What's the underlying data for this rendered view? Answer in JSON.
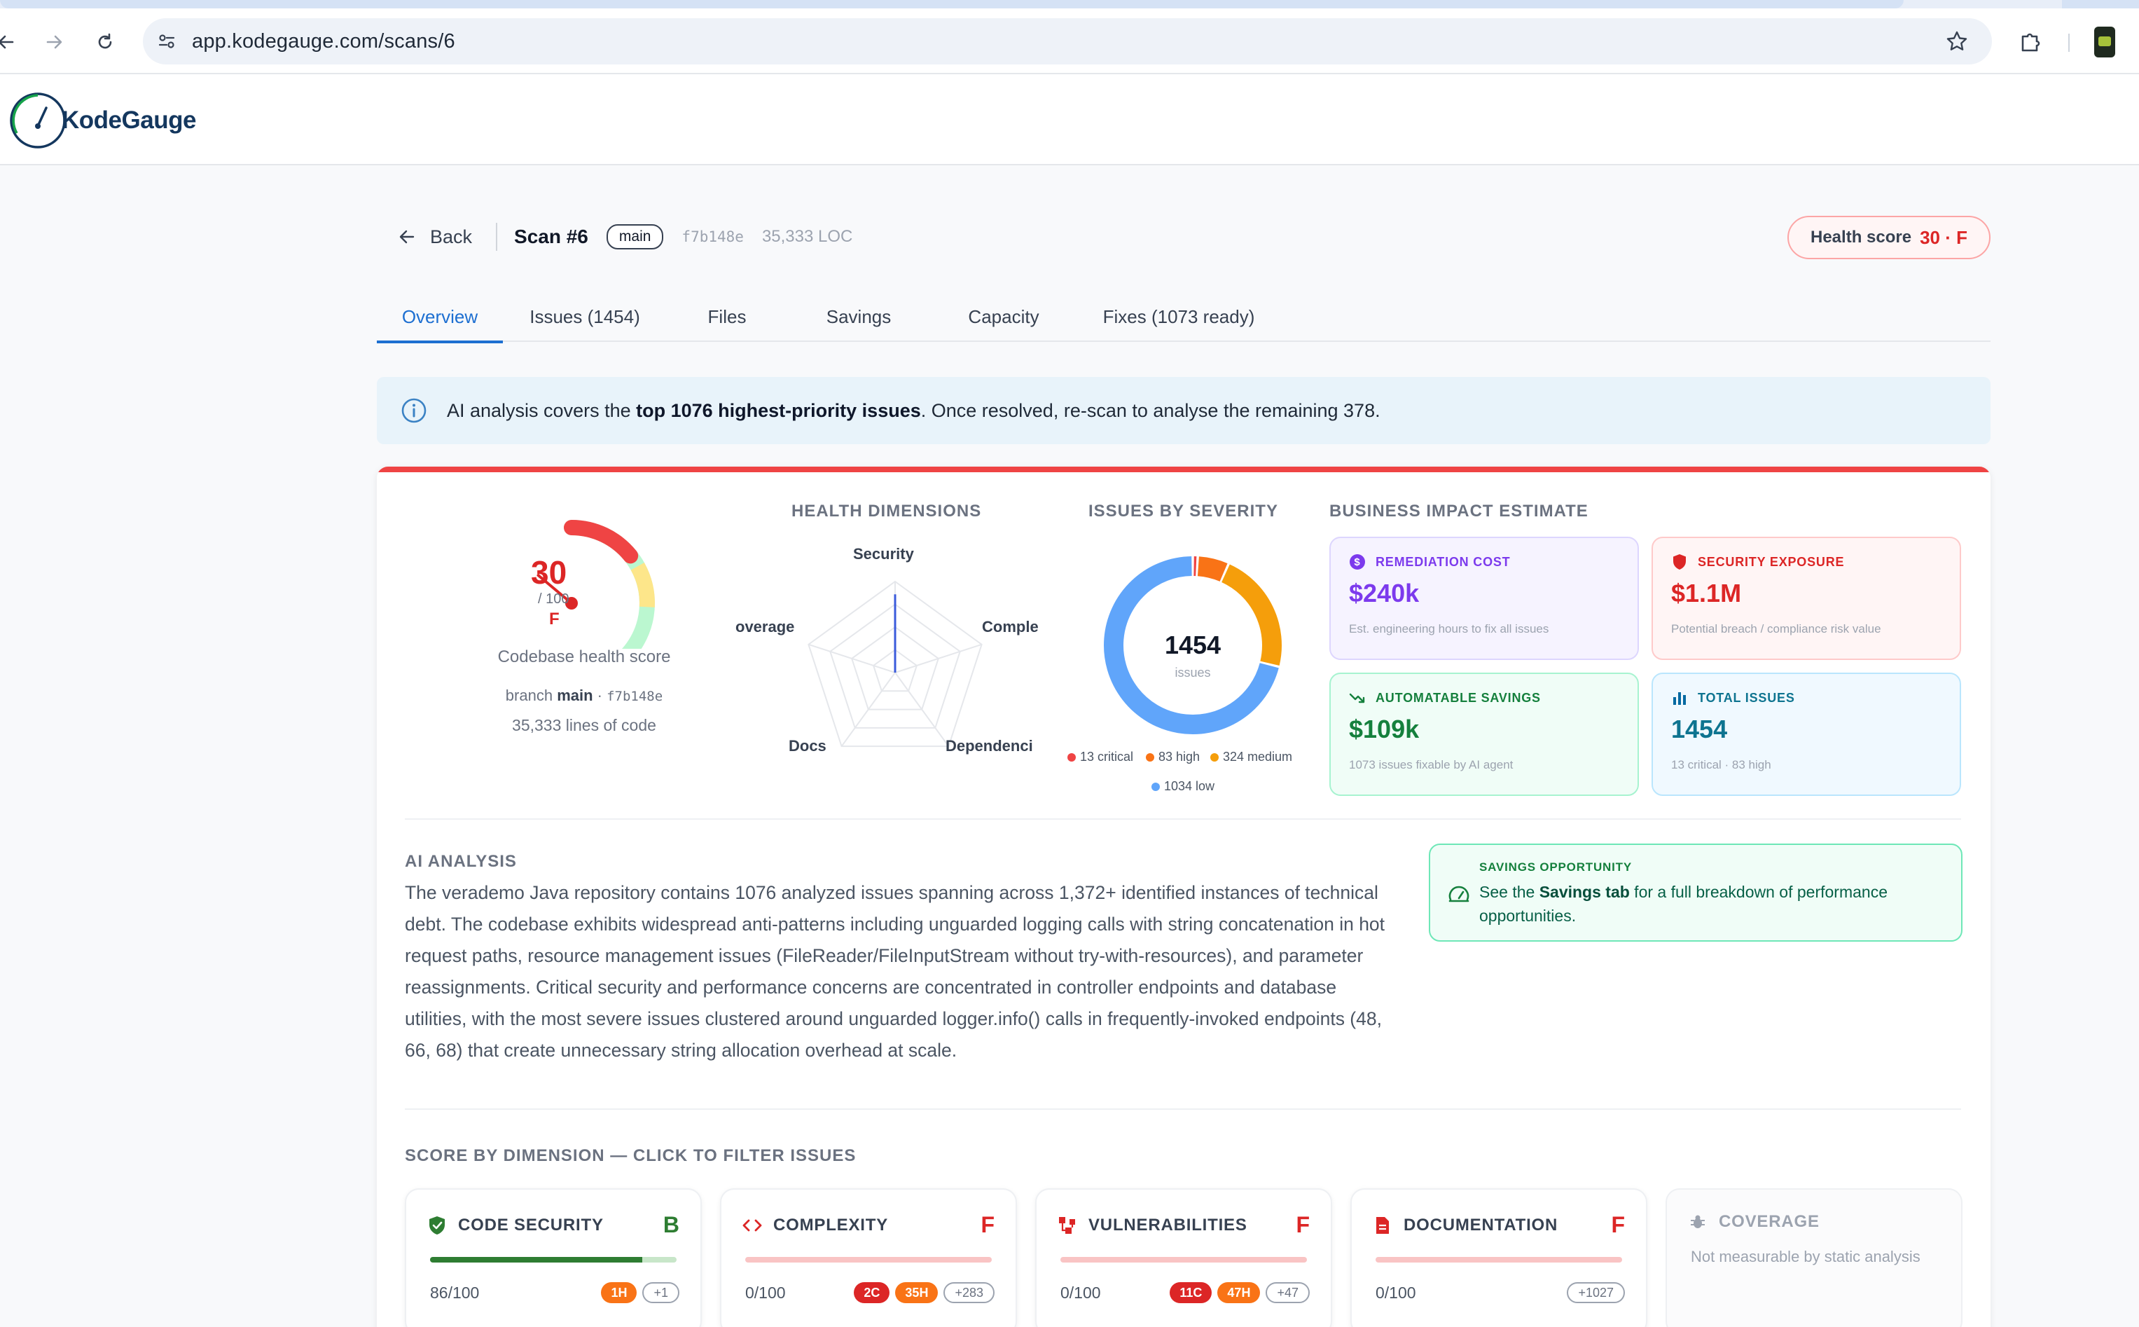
{
  "browser": {
    "url": "app.kodegauge.com/scans/6"
  },
  "app": {
    "name": "KodeGauge"
  },
  "scan": {
    "back_label": "Back",
    "title": "Scan #6",
    "branch": "main",
    "sha": "f7b148e",
    "loc": "35,333 LOC",
    "health_label": "Health score",
    "health_value": "30 · F"
  },
  "tabs": [
    {
      "label": "Overview",
      "active": true
    },
    {
      "label": "Issues (1454)"
    },
    {
      "label": "Files"
    },
    {
      "label": "Savings"
    },
    {
      "label": "Capacity"
    },
    {
      "label": "Fixes (1073 ready)"
    }
  ],
  "banner": {
    "prefix": "AI analysis covers the ",
    "bold": "top 1076 highest-priority issues",
    "suffix": ". Once resolved, re-scan to analyse the remaining 378."
  },
  "gauge": {
    "score": "30",
    "out_of": "/ 100",
    "grade": "F",
    "value_fraction": 0.3,
    "caption": "Codebase health score",
    "branch_prefix": "branch ",
    "branch": "main",
    "sep": " · ",
    "sha": "f7b148e",
    "lines": "35,333 lines of code"
  },
  "health_dimensions": {
    "title": "HEALTH DIMENSIONS",
    "labels": [
      "Security",
      "Comple",
      "Dependenci",
      "Docs",
      "overage"
    ],
    "values": [
      86,
      0,
      0,
      0,
      0
    ]
  },
  "severity": {
    "title": "ISSUES BY SEVERITY",
    "total": "1454",
    "total_label": "issues",
    "slices": [
      {
        "label": "13 critical",
        "value": 13,
        "color": "#ef4444"
      },
      {
        "label": "83 high",
        "value": 83,
        "color": "#f97316"
      },
      {
        "label": "324 medium",
        "value": 324,
        "color": "#f59e0b"
      },
      {
        "label": "1034 low",
        "value": 1034,
        "color": "#60a5fa"
      }
    ]
  },
  "impact": {
    "title": "BUSINESS IMPACT ESTIMATE",
    "remediation": {
      "label": "REMEDIATION COST",
      "value": "$240k",
      "sub": "Est. engineering hours to fix all issues"
    },
    "security": {
      "label": "SECURITY EXPOSURE",
      "value": "$1.1M",
      "sub": "Potential breach / compliance risk value"
    },
    "savings": {
      "label": "AUTOMATABLE SAVINGS",
      "value": "$109k",
      "sub": "1073 issues fixable by AI agent"
    },
    "total": {
      "label": "TOTAL ISSUES",
      "value": "1454",
      "sub": "13 critical · 83 high"
    }
  },
  "ai": {
    "title": "AI ANALYSIS",
    "text": "The verademo Java repository contains 1076 analyzed issues spanning across 1,372+ identified instances of technical debt. The codebase exhibits widespread anti-patterns including unguarded logging calls with string concatenation in hot request paths, resource management issues (FileReader/FileInputStream without try-with-resources), and parameter reassignments. Critical security and performance concerns are concentrated in controller endpoints and database utilities, with the most severe issues clustered around unguarded logger.info() calls in frequently-invoked endpoints (48, 66, 68) that create unnecessary string allocation overhead at scale."
  },
  "savings_opportunity": {
    "label": "SAVINGS OPPORTUNITY",
    "prefix": "See the ",
    "bold": "Savings tab",
    "suffix": " for a full breakdown of performance opportunities."
  },
  "dimensions": {
    "title": "SCORE BY DIMENSION — CLICK TO FILTER ISSUES",
    "cards": [
      {
        "name": "CODE SECURITY",
        "grade": "B",
        "score": "86/100",
        "fraction": 0.86,
        "badges": [
          {
            "t": "1H",
            "k": "orange"
          },
          {
            "t": "+1",
            "k": "more"
          }
        ]
      },
      {
        "name": "COMPLEXITY",
        "grade": "F",
        "score": "0/100",
        "fraction": 0,
        "badges": [
          {
            "t": "2C",
            "k": "red"
          },
          {
            "t": "35H",
            "k": "orange"
          },
          {
            "t": "+283",
            "k": "more"
          }
        ]
      },
      {
        "name": "VULNERABILITIES",
        "grade": "F",
        "score": "0/100",
        "fraction": 0,
        "badges": [
          {
            "t": "11C",
            "k": "red"
          },
          {
            "t": "47H",
            "k": "orange"
          },
          {
            "t": "+47",
            "k": "more"
          }
        ]
      },
      {
        "name": "DOCUMENTATION",
        "grade": "F",
        "score": "0/100",
        "fraction": 0,
        "badges": [
          {
            "t": "+1027",
            "k": "more"
          }
        ]
      },
      {
        "name": "COVERAGE",
        "note": "Not measurable by static analysis"
      }
    ]
  },
  "colors": {
    "accent": "#1d6fd1",
    "danger": "#dc2626",
    "good": "#2e7d32"
  }
}
